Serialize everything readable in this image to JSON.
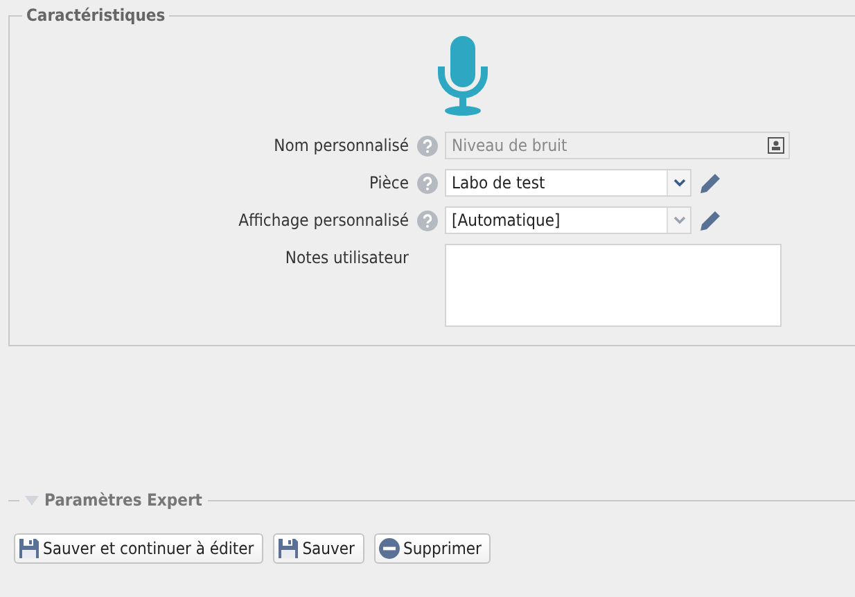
{
  "characteristics": {
    "title": "Caractéristiques",
    "fields": [
      {
        "kind": "text",
        "label": "Nom personnalisé",
        "help": true,
        "placeholder": "Niveau de bruit"
      },
      {
        "kind": "select",
        "label": "Pièce",
        "help": true,
        "value": "Labo de test"
      },
      {
        "kind": "select",
        "label": "Affichage personnalisé",
        "help": true,
        "value": "[Automatique]"
      },
      {
        "kind": "textarea",
        "label": "Notes utilisateur",
        "help": false
      }
    ]
  },
  "expert": {
    "title": "Paramètres Expert",
    "expanded": false
  },
  "buttons": [
    {
      "kind": "save",
      "label": "Sauver et continuer à éditer"
    },
    {
      "kind": "save",
      "label": "Sauver"
    },
    {
      "kind": "delete",
      "label": "Supprimer"
    }
  ]
}
